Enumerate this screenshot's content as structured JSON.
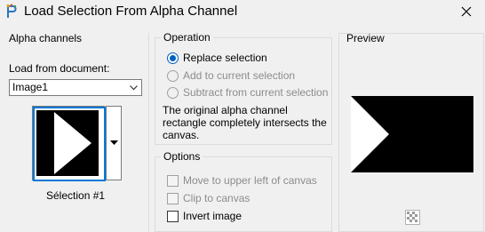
{
  "window": {
    "title": "Load Selection From Alpha Channel"
  },
  "alpha_channels": {
    "heading": "Alpha channels",
    "load_label": "Load from document:",
    "document_value": "Image1",
    "channel_name": "Sélection #1"
  },
  "operation": {
    "heading": "Operation",
    "options": [
      {
        "label": "Replace selection",
        "checked": true,
        "enabled": true
      },
      {
        "label": "Add to current selection",
        "checked": false,
        "enabled": false
      },
      {
        "label": "Subtract from current selection",
        "checked": false,
        "enabled": false
      }
    ],
    "description": "The original alpha channel rectangle completely intersects the canvas."
  },
  "options": {
    "heading": "Options",
    "items": [
      {
        "label": "Move to upper left of canvas",
        "checked": false,
        "enabled": false
      },
      {
        "label": "Clip to canvas",
        "checked": false,
        "enabled": false
      },
      {
        "label": "Invert image",
        "checked": false,
        "enabled": true
      }
    ]
  },
  "preview": {
    "heading": "Preview"
  },
  "colors": {
    "accent": "#0078d7",
    "background": "#f0f0f0"
  }
}
